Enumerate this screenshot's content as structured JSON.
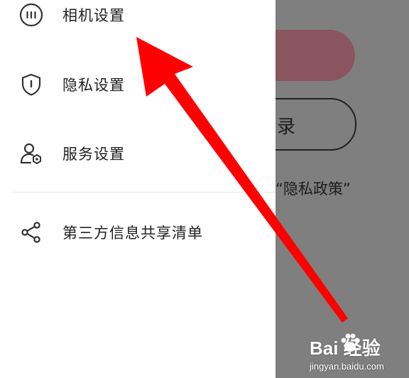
{
  "drawer": {
    "items": [
      {
        "label": "相机设置",
        "icon": "camera-settings-icon"
      },
      {
        "label": "隐私设置",
        "icon": "shield-icon"
      },
      {
        "label": "服务设置",
        "icon": "user-gear-icon"
      },
      {
        "label": "第三方信息共享清单",
        "icon": "share-icon"
      }
    ]
  },
  "background": {
    "primary_button_fragment": "",
    "outline_button_fragment": "录",
    "policy_text": "“隐私政策”"
  },
  "annotation": {
    "arrow_color": "#ff0000"
  },
  "watermark": {
    "brand": "Bai  经验",
    "url": "jingyan.baidu.com"
  }
}
